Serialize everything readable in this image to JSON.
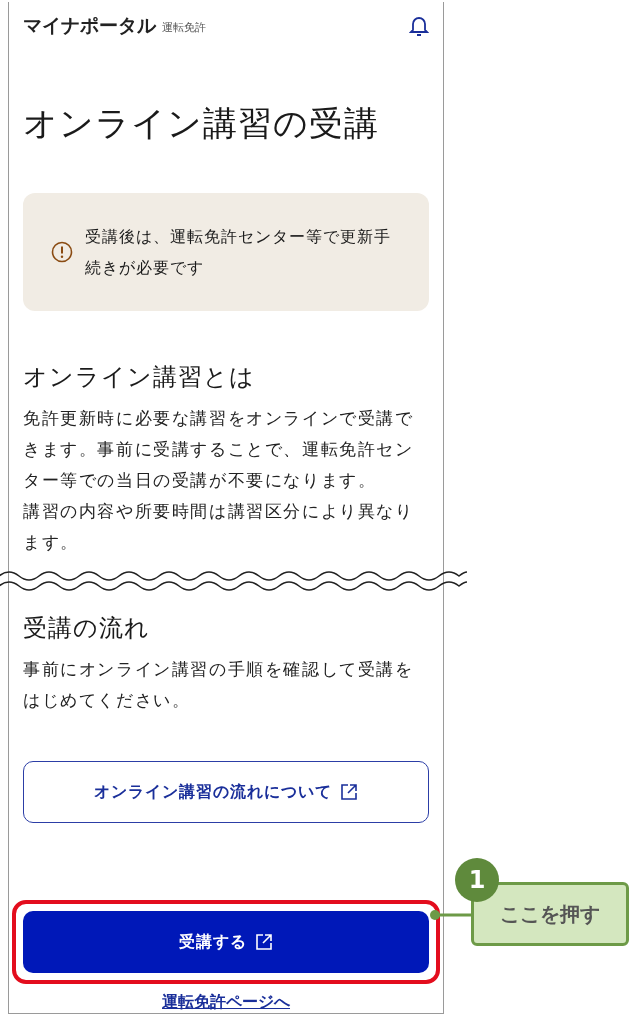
{
  "header": {
    "app_name": "マイナポータル",
    "section": "運転免許"
  },
  "title": "オンライン講習の受講",
  "alert": {
    "text": "受講後は、運転免許センター等で更新手続きが必要です"
  },
  "sections": [
    {
      "heading": "オンライン講習とは",
      "paragraphs": [
        "免許更新時に必要な講習をオンラインで受講できます。事前に受講することで、運転免許センター等での当日の受講が不要になります。",
        "講習の内容や所要時間は講習区分により異なります。"
      ]
    },
    {
      "heading": "受講の流れ",
      "paragraphs": [
        "事前にオンライン講習の手順を確認して受講をはじめてください。"
      ]
    }
  ],
  "buttons": [
    {
      "kind": "outline",
      "label": "オンライン講習の流れについて",
      "highlighted": false
    },
    {
      "kind": "primary",
      "label": "受講する",
      "highlighted": true
    }
  ],
  "link": "運転免許ページへ",
  "callout": {
    "number": "1",
    "label": "ここを押す"
  }
}
